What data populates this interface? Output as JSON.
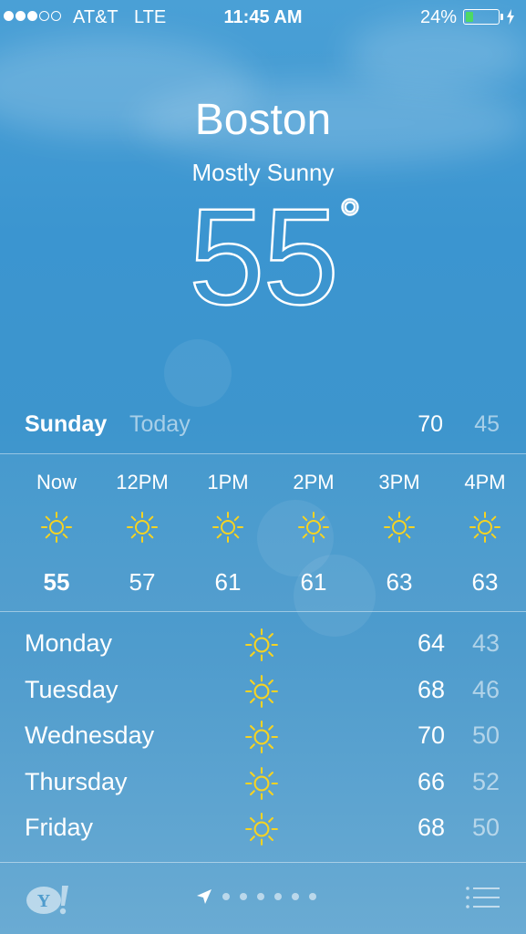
{
  "status_bar": {
    "signal_dots_filled": 3,
    "signal_dots_total": 5,
    "carrier": "AT&T",
    "network": "LTE",
    "time": "11:45 AM",
    "battery_percent": "24%",
    "battery_level": 0.24,
    "battery_color": "#4cd964"
  },
  "header": {
    "city": "Boston",
    "condition": "Mostly Sunny",
    "temperature": "55",
    "degree": "°"
  },
  "today": {
    "day": "Sunday",
    "label": "Today",
    "high": "70",
    "low": "45"
  },
  "hourly": [
    {
      "time": "Now",
      "icon": "sun-icon",
      "temp": "55",
      "current": true
    },
    {
      "time": "12PM",
      "icon": "sun-icon",
      "temp": "57"
    },
    {
      "time": "1PM",
      "icon": "sun-icon",
      "temp": "61"
    },
    {
      "time": "2PM",
      "icon": "sun-icon",
      "temp": "61"
    },
    {
      "time": "3PM",
      "icon": "sun-icon",
      "temp": "63"
    },
    {
      "time": "4PM",
      "icon": "sun-icon",
      "temp": "63"
    }
  ],
  "daily": [
    {
      "day": "Monday",
      "icon": "sun-icon",
      "high": "64",
      "low": "43"
    },
    {
      "day": "Tuesday",
      "icon": "sun-icon",
      "high": "68",
      "low": "46"
    },
    {
      "day": "Wednesday",
      "icon": "sun-icon",
      "high": "70",
      "low": "50"
    },
    {
      "day": "Thursday",
      "icon": "sun-icon",
      "high": "66",
      "low": "52"
    },
    {
      "day": "Friday",
      "icon": "sun-icon",
      "high": "68",
      "low": "50"
    }
  ],
  "bottom_bar": {
    "logo": "yahoo-logo",
    "location_icon": "location-arrow-icon",
    "page_count": 6,
    "list_icon": "list-icon"
  },
  "colors": {
    "sun": "#f6d322",
    "sky": "#3d95cd"
  }
}
